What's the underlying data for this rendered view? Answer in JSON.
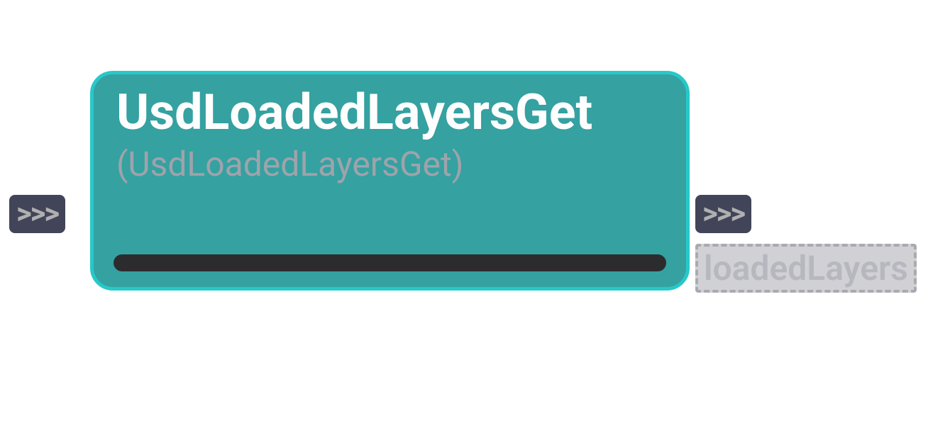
{
  "node": {
    "title": "UsdLoadedLayersGet",
    "subtitle": "(UsdLoadedLayersGet)"
  },
  "ports": {
    "input_symbol": ">>>",
    "output_symbol": ">>>"
  },
  "outputs": {
    "label": "loadedLayers"
  }
}
